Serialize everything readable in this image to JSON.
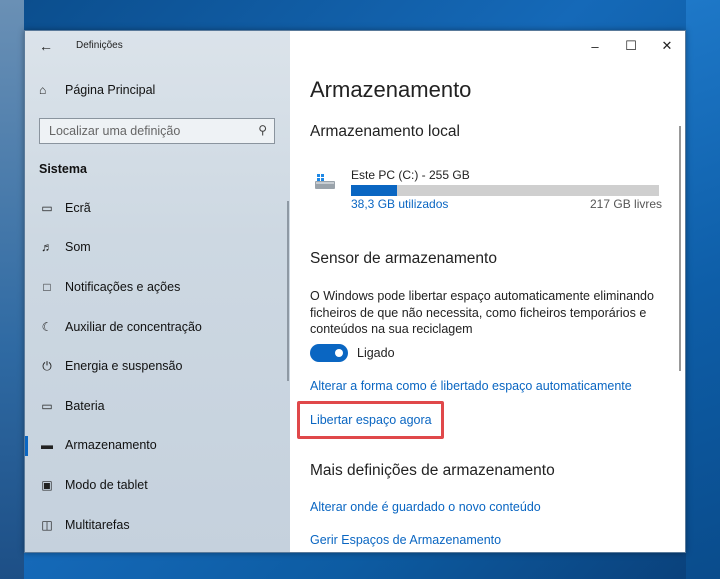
{
  "window": {
    "app_title": "Definições"
  },
  "sidebar": {
    "home_label": "Página Principal",
    "search_placeholder": "Localizar uma definição",
    "section": "Sistema",
    "items": [
      {
        "label": "Ecrã",
        "icon": "display-icon"
      },
      {
        "label": "Som",
        "icon": "speaker-icon"
      },
      {
        "label": "Notificações e ações",
        "icon": "notification-icon"
      },
      {
        "label": "Auxiliar de concentração",
        "icon": "moon-icon"
      },
      {
        "label": "Energia e suspensão",
        "icon": "power-icon"
      },
      {
        "label": "Bateria",
        "icon": "battery-icon"
      },
      {
        "label": "Armazenamento",
        "icon": "storage-icon",
        "active": true
      },
      {
        "label": "Modo de tablet",
        "icon": "tablet-icon"
      },
      {
        "label": "Multitarefas",
        "icon": "multitask-icon"
      }
    ]
  },
  "main": {
    "title": "Armazenamento",
    "local_heading": "Armazenamento local",
    "drive": {
      "name": "Este PC (C:) - 255 GB",
      "used": "38,3 GB utilizados",
      "free": "217 GB livres",
      "used_fraction": 0.15
    },
    "sensor_heading": "Sensor de armazenamento",
    "sensor_description": "O Windows pode libertar espaço automaticamente eliminando ficheiros de que não necessita, como ficheiros temporários e conteúdos na sua reciclagem",
    "toggle_label": "Ligado",
    "link_change": "Alterar a forma como é libertado espaço automaticamente",
    "link_free_now": "Libertar espaço agora",
    "more_heading": "Mais definições de armazenamento",
    "link_change_location": "Alterar onde é guardado o novo conteúdo",
    "link_manage_spaces": "Gerir Espaços de Armazenamento"
  },
  "colors": {
    "accent": "#0a66c2",
    "highlight": "#e0484a"
  }
}
